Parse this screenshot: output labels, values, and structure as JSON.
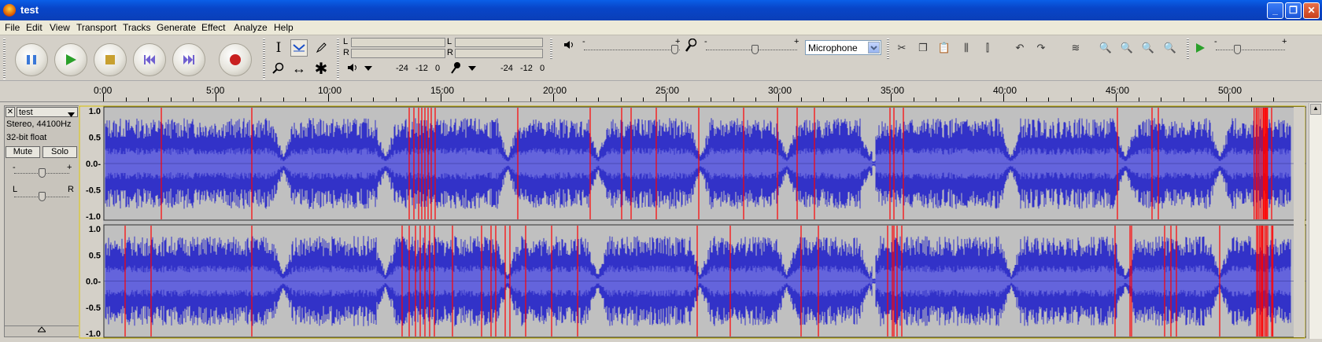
{
  "window": {
    "title": "test"
  },
  "menu": [
    "File",
    "Edit",
    "View",
    "Transport",
    "Tracks",
    "Generate",
    "Effect",
    "Analyze",
    "Help"
  ],
  "transport": {
    "buttons": [
      "pause",
      "play",
      "stop",
      "skip-start",
      "skip-end",
      "record"
    ]
  },
  "tools": [
    "I",
    "↔",
    "✱"
  ],
  "meters": {
    "channel_l": "L",
    "channel_r": "R",
    "scale": [
      "-24",
      "-12",
      "0"
    ],
    "scale2": [
      "-24",
      "-12",
      "0"
    ]
  },
  "mixer": {
    "minus": "-",
    "plus": "+",
    "input_source": "Microphone"
  },
  "ruler": {
    "labels": [
      "0:00",
      "5:00",
      "10:00",
      "15:00",
      "20:00",
      "25:00",
      "30:00",
      "35:00",
      "40:00",
      "45:00",
      "50:00"
    ]
  },
  "track": {
    "name": "test",
    "format": "Stereo, 44100Hz",
    "bitdepth": "32-bit float",
    "mute": "Mute",
    "solo": "Solo",
    "pan_left": "L",
    "pan_right": "R",
    "gain_minus": "-",
    "gain_plus": "+",
    "amplitude_labels": [
      "1.0",
      "0.5",
      "0.0-",
      "-0.5",
      "-1.0"
    ],
    "waveform_color": "#3232c8",
    "rms_color": "#6464dc",
    "clip_color": "#ff0000"
  }
}
